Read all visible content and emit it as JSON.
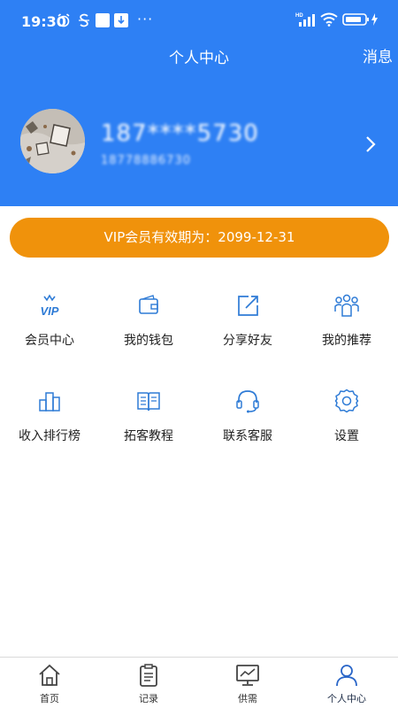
{
  "status_bar": {
    "time": "19:30",
    "more": "···",
    "icons": [
      "alarm-icon",
      "s-app-icon",
      "white-box-icon",
      "download-icon",
      "hd-signal-icon",
      "wifi-icon",
      "battery-charging-icon"
    ]
  },
  "header": {
    "title": "个人中心",
    "message_link": "消息",
    "background_color": "#2e80f4"
  },
  "profile": {
    "phone_masked": "187****5730",
    "sub_id": "18778886730",
    "avatar_icon": "user-avatar-photo",
    "chevron_icon": "chevron-right-icon"
  },
  "vip": {
    "label": "VIP会员有效期为：2099-12-31",
    "color": "#f0920b"
  },
  "menu": [
    {
      "label": "会员中心",
      "icon": "vip-crown-icon"
    },
    {
      "label": "我的钱包",
      "icon": "wallet-icon"
    },
    {
      "label": "分享好友",
      "icon": "share-icon"
    },
    {
      "label": "我的推荐",
      "icon": "group-icon"
    },
    {
      "label": "收入排行榜",
      "icon": "ranking-icon"
    },
    {
      "label": "拓客教程",
      "icon": "book-icon"
    },
    {
      "label": "联系客服",
      "icon": "headset-icon"
    },
    {
      "label": "设置",
      "icon": "settings-gear-icon"
    }
  ],
  "tabs": [
    {
      "label": "首页",
      "icon": "home-icon"
    },
    {
      "label": "记录",
      "icon": "clipboard-icon"
    },
    {
      "label": "供需",
      "icon": "monitor-chart-icon"
    },
    {
      "label": "个人中心",
      "icon": "person-icon",
      "active": true
    }
  ],
  "accent_icon_color": "#2e7bd6"
}
